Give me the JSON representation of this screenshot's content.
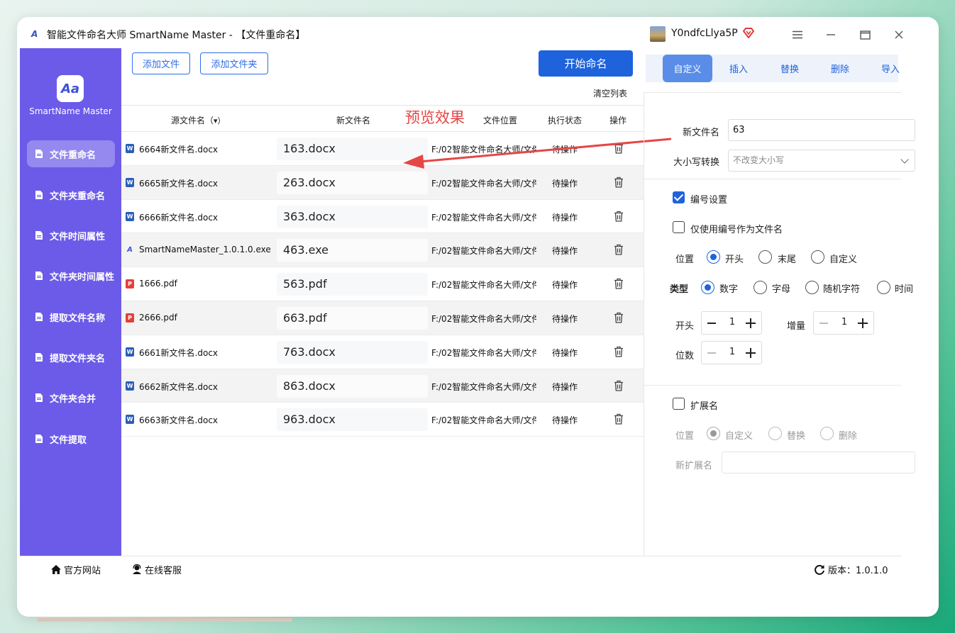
{
  "window": {
    "title": "智能文件命名大师 SmartName Master - 【文件重命名】",
    "username": "Y0ndfcLlya5P"
  },
  "sidebar": {
    "logo_text": "SmartName Master",
    "items": [
      {
        "label": "文件重命名",
        "active": true
      },
      {
        "label": "文件夹重命名",
        "active": false
      },
      {
        "label": "文件时间属性",
        "active": false
      },
      {
        "label": "文件夹时间属性",
        "active": false
      },
      {
        "label": "提取文件名称",
        "active": false
      },
      {
        "label": "提取文件夹名",
        "active": false
      },
      {
        "label": "文件夹合并",
        "active": false
      },
      {
        "label": "文件提取",
        "active": false
      }
    ]
  },
  "toolbar": {
    "add_file": "添加文件",
    "add_folder": "添加文件夹",
    "start_rename": "开始命名",
    "clear_list": "清空列表"
  },
  "table": {
    "headers": {
      "source": "源文件名（",
      "new_name": "新文件名",
      "location": "文件位置",
      "status": "执行状态",
      "action": "操作"
    },
    "rows": [
      {
        "icon": "word",
        "source": "6664新文件名.docx",
        "new_name": "163.docx",
        "location": "F:/02智能文件命名大师/文件",
        "status": "待操作"
      },
      {
        "icon": "word",
        "source": "6665新文件名.docx",
        "new_name": "263.docx",
        "location": "F:/02智能文件命名大师/文件",
        "status": "待操作"
      },
      {
        "icon": "word",
        "source": "6666新文件名.docx",
        "new_name": "363.docx",
        "location": "F:/02智能文件命名大师/文件",
        "status": "待操作"
      },
      {
        "icon": "exe",
        "source": "SmartNameMaster_1.0.1.0.exe",
        "new_name": "463.exe",
        "location": "F:/02智能文件命名大师/文件",
        "status": "待操作"
      },
      {
        "icon": "pdf",
        "source": "1666.pdf",
        "new_name": "563.pdf",
        "location": "F:/02智能文件命名大师/文件",
        "status": "待操作"
      },
      {
        "icon": "pdf",
        "source": "2666.pdf",
        "new_name": "663.pdf",
        "location": "F:/02智能文件命名大师/文件",
        "status": "待操作"
      },
      {
        "icon": "word",
        "source": "6661新文件名.docx",
        "new_name": "763.docx",
        "location": "F:/02智能文件命名大师/文件",
        "status": "待操作"
      },
      {
        "icon": "word",
        "source": "6662新文件名.docx",
        "new_name": "863.docx",
        "location": "F:/02智能文件命名大师/文件",
        "status": "待操作"
      },
      {
        "icon": "word",
        "source": "6663新文件名.docx",
        "new_name": "963.docx",
        "location": "F:/02智能文件命名大师/文件",
        "status": "待操作"
      }
    ]
  },
  "annotation": {
    "text": "预览效果",
    "color": "#e64646"
  },
  "panel": {
    "tabs": [
      {
        "label": "自定义",
        "active": true
      },
      {
        "label": "插入",
        "active": false
      },
      {
        "label": "替换",
        "active": false
      },
      {
        "label": "删除",
        "active": false
      },
      {
        "label": "导入",
        "active": false
      }
    ],
    "new_name_label": "新文件名",
    "new_name_value": "63",
    "case_label": "大小写转换",
    "case_value": "不改变大小写",
    "numbering_label": "编号设置",
    "numbering_checked": true,
    "only_number_label": "仅使用编号作为文件名",
    "only_number_checked": false,
    "position_label": "位置",
    "position_options": [
      "开头",
      "末尾",
      "自定义"
    ],
    "position_selected": "开头",
    "type_label": "类型",
    "type_options": [
      "数字",
      "字母",
      "随机字符",
      "时间"
    ],
    "type_selected": "数字",
    "start_label": "开头",
    "start_value": "1",
    "increment_label": "增量",
    "increment_value": "1",
    "digits_label": "位数",
    "digits_value": "1",
    "ext_label": "扩展名",
    "ext_checked": false,
    "ext_position_label": "位置",
    "ext_options": [
      "自定义",
      "替换",
      "删除"
    ],
    "ext_selected": "自定义",
    "new_ext_label": "新扩展名",
    "new_ext_value": ""
  },
  "footer": {
    "website": "官方网站",
    "support": "在线客服",
    "version": "版本：1.0.1.0"
  },
  "colors": {
    "sidebar": "#6c5be8",
    "primary": "#1e63dc",
    "accent_red": "#e64646"
  }
}
